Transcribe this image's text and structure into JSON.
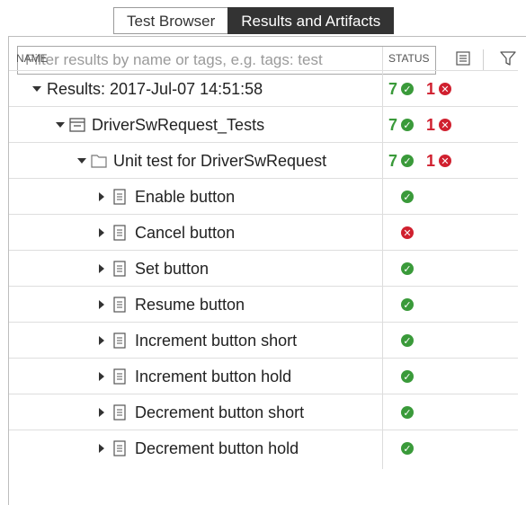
{
  "tabs": [
    {
      "label": "Test Browser",
      "active": false
    },
    {
      "label": "Results and Artifacts",
      "active": true
    }
  ],
  "filter": {
    "placeholder": "Filter results by name or tags, e.g. tags: test",
    "value": ""
  },
  "toolbar": {
    "icons": [
      "list-view-icon",
      "filter-funnel-icon"
    ]
  },
  "columns": {
    "name": "NAME",
    "status": "STATUS"
  },
  "colors": {
    "pass": "#3a9a3a",
    "fail": "#d0202f",
    "active_tab": "#333333"
  },
  "tree": [
    {
      "label": "Results: 2017-Jul-07 14:51:58",
      "level": 0,
      "kind": "root",
      "expanded": true,
      "passed": "7",
      "failed": "1"
    },
    {
      "label": "DriverSwRequest_Tests",
      "level": 1,
      "kind": "suite",
      "expanded": true,
      "passed": "7",
      "failed": "1"
    },
    {
      "label": "Unit test for DriverSwRequest",
      "level": 2,
      "kind": "folder",
      "expanded": true,
      "passed": "7",
      "failed": "1"
    },
    {
      "label": "Enable button",
      "level": 3,
      "kind": "test",
      "expanded": false,
      "status": "pass"
    },
    {
      "label": "Cancel button",
      "level": 3,
      "kind": "test",
      "expanded": false,
      "status": "fail"
    },
    {
      "label": "Set button",
      "level": 3,
      "kind": "test",
      "expanded": false,
      "status": "pass"
    },
    {
      "label": "Resume button",
      "level": 3,
      "kind": "test",
      "expanded": false,
      "status": "pass"
    },
    {
      "label": "Increment button short",
      "level": 3,
      "kind": "test",
      "expanded": false,
      "status": "pass"
    },
    {
      "label": "Increment button hold",
      "level": 3,
      "kind": "test",
      "expanded": false,
      "status": "pass"
    },
    {
      "label": "Decrement button short",
      "level": 3,
      "kind": "test",
      "expanded": false,
      "status": "pass"
    },
    {
      "label": "Decrement button hold",
      "level": 3,
      "kind": "test",
      "expanded": false,
      "status": "pass"
    }
  ]
}
